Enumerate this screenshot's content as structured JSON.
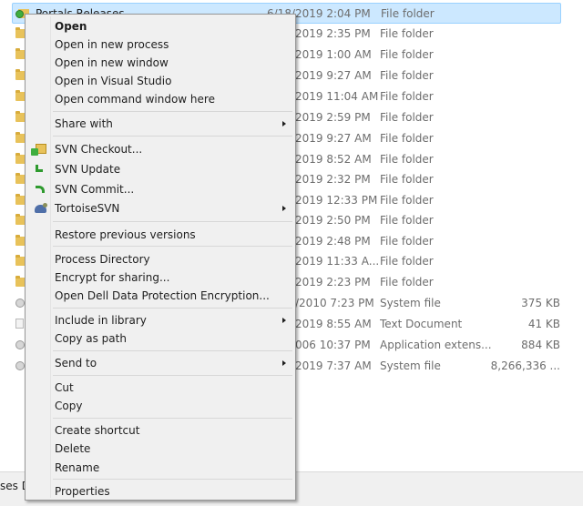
{
  "file_list": {
    "rows": [
      {
        "name": "Portals Releases",
        "date": "6/18/2019 2:04 PM",
        "type": "File folder",
        "size": "",
        "icon": "svn-folder-icon"
      },
      {
        "name": "",
        "date": "2019 2:35 PM",
        "type": "File folder",
        "size": "",
        "icon": "folder-icon"
      },
      {
        "name": "",
        "date": "2019 1:00 AM",
        "type": "File folder",
        "size": "",
        "icon": "folder-icon"
      },
      {
        "name": "",
        "date": "2019 9:27 AM",
        "type": "File folder",
        "size": "",
        "icon": "folder-icon"
      },
      {
        "name": "",
        "date": "2019 11:04 AM",
        "type": "File folder",
        "size": "",
        "icon": "folder-icon"
      },
      {
        "name": "",
        "date": "2019 2:59 PM",
        "type": "File folder",
        "size": "",
        "icon": "folder-icon"
      },
      {
        "name": "",
        "date": "2019 9:27 AM",
        "type": "File folder",
        "size": "",
        "icon": "folder-icon"
      },
      {
        "name": "",
        "date": "2019 8:52 AM",
        "type": "File folder",
        "size": "",
        "icon": "folder-icon"
      },
      {
        "name": "",
        "date": "2019 2:32 PM",
        "type": "File folder",
        "size": "",
        "icon": "folder-icon"
      },
      {
        "name": "",
        "date": "2019 12:33 PM",
        "type": "File folder",
        "size": "",
        "icon": "folder-icon"
      },
      {
        "name": "",
        "date": "2019 2:50 PM",
        "type": "File folder",
        "size": "",
        "icon": "folder-icon"
      },
      {
        "name": "",
        "date": "2019 2:48 PM",
        "type": "File folder",
        "size": "",
        "icon": "folder-icon"
      },
      {
        "name": "",
        "date": "2019 11:33 A...",
        "type": "File folder",
        "size": "",
        "icon": "folder-icon"
      },
      {
        "name": "",
        "date": "2019 2:23 PM",
        "type": "File folder",
        "size": "",
        "icon": "folder-icon"
      },
      {
        "name": "",
        "date": "/2010 7:23 PM",
        "type": "System file",
        "size": "375 KB",
        "icon": "gear-file-icon"
      },
      {
        "name": "",
        "date": "2019 8:55 AM",
        "type": "Text Document",
        "size": "41 KB",
        "icon": "text-file-icon"
      },
      {
        "name": "",
        "date": "006 10:37 PM",
        "type": "Application extens...",
        "size": "884 KB",
        "icon": "gear-file-icon"
      },
      {
        "name": "",
        "date": "2019 7:37 AM",
        "type": "System file",
        "size": "8,266,336 ...",
        "icon": "gear-file-icon"
      }
    ]
  },
  "status_bar": {
    "text": "ses D"
  },
  "context_menu": {
    "items": [
      {
        "id": "open",
        "label": "Open",
        "bold": true,
        "submenu": false,
        "icon": ""
      },
      {
        "id": "open-new-process",
        "label": "Open in new process",
        "submenu": false,
        "icon": ""
      },
      {
        "id": "open-new-window",
        "label": "Open in new window",
        "submenu": false,
        "icon": ""
      },
      {
        "id": "open-visual-studio",
        "label": "Open in Visual Studio",
        "submenu": false,
        "icon": ""
      },
      {
        "id": "open-command-window",
        "label": "Open command window here",
        "submenu": false,
        "icon": ""
      },
      {
        "id": "share-with",
        "label": "Share with",
        "submenu": true,
        "icon": ""
      },
      {
        "id": "svn-checkout",
        "label": "SVN Checkout...",
        "submenu": false,
        "icon": "svn-checkout-icon"
      },
      {
        "id": "svn-update",
        "label": "SVN Update",
        "submenu": false,
        "icon": "svn-update-icon"
      },
      {
        "id": "svn-commit",
        "label": "SVN Commit...",
        "submenu": false,
        "icon": "svn-commit-icon"
      },
      {
        "id": "tortoisesvn",
        "label": "TortoiseSVN",
        "submenu": true,
        "icon": "tortoisesvn-icon"
      },
      {
        "id": "restore-previous",
        "label": "Restore previous versions",
        "submenu": false,
        "icon": ""
      },
      {
        "id": "process-directory",
        "label": "Process Directory",
        "submenu": false,
        "icon": ""
      },
      {
        "id": "encrypt-sharing",
        "label": "Encrypt for sharing...",
        "submenu": false,
        "icon": ""
      },
      {
        "id": "open-dell-encryption",
        "label": "Open Dell Data Protection Encryption...",
        "submenu": false,
        "icon": ""
      },
      {
        "id": "include-library",
        "label": "Include in library",
        "submenu": true,
        "icon": ""
      },
      {
        "id": "copy-as-path",
        "label": "Copy as path",
        "submenu": false,
        "icon": ""
      },
      {
        "id": "send-to",
        "label": "Send to",
        "submenu": true,
        "icon": ""
      },
      {
        "id": "cut",
        "label": "Cut",
        "submenu": false,
        "icon": ""
      },
      {
        "id": "copy",
        "label": "Copy",
        "submenu": false,
        "icon": ""
      },
      {
        "id": "create-shortcut",
        "label": "Create shortcut",
        "submenu": false,
        "icon": ""
      },
      {
        "id": "delete",
        "label": "Delete",
        "submenu": false,
        "icon": ""
      },
      {
        "id": "rename",
        "label": "Rename",
        "submenu": false,
        "icon": ""
      },
      {
        "id": "properties",
        "label": "Properties",
        "submenu": false,
        "icon": ""
      }
    ]
  }
}
